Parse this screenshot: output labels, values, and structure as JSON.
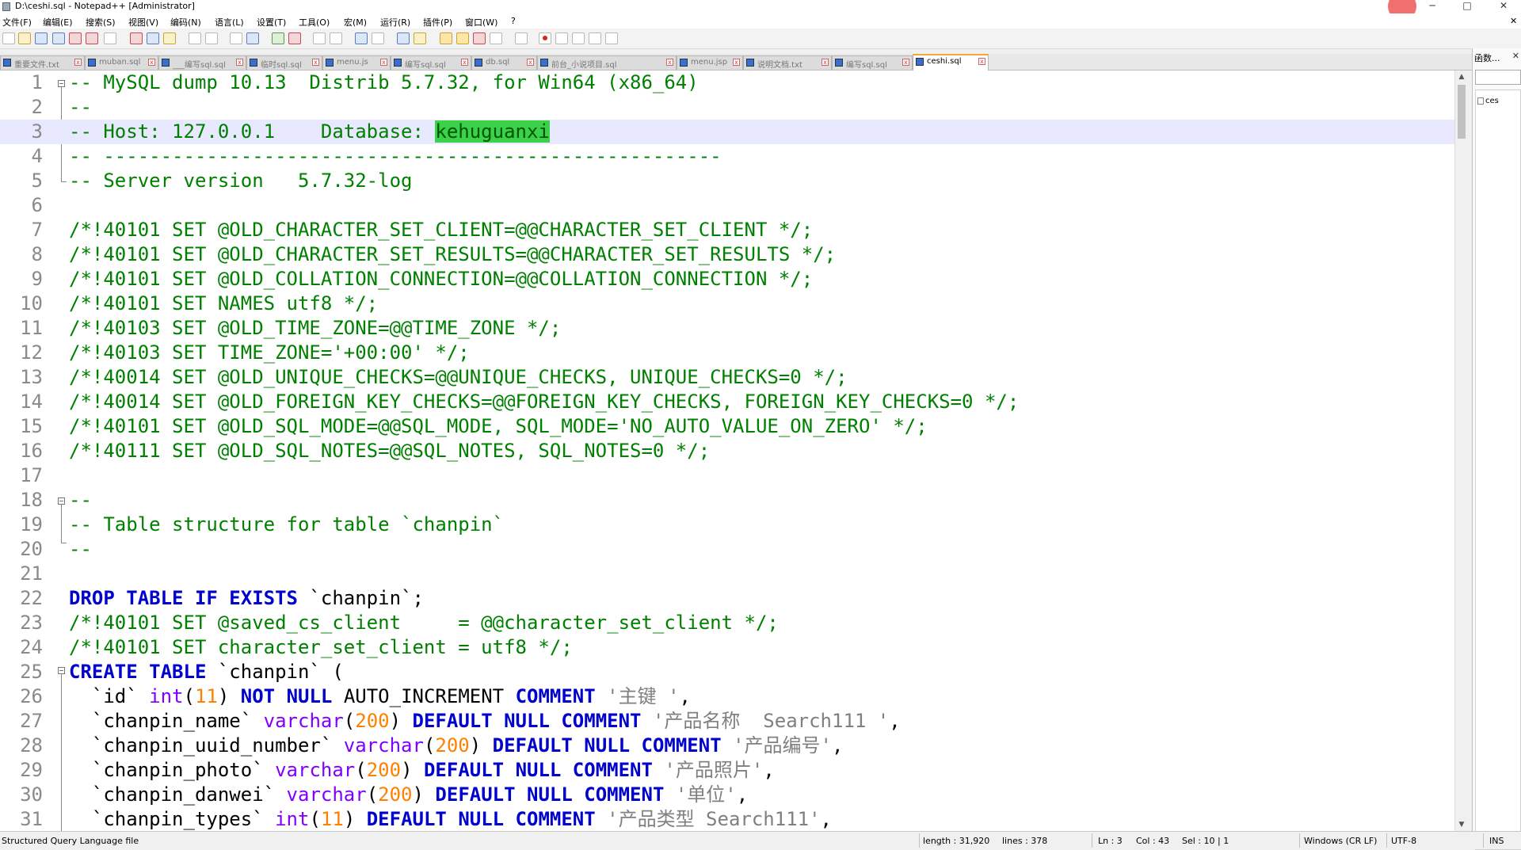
{
  "window": {
    "title": "D:\\ceshi.sql - Notepad++ [Administrator]",
    "minimize": "─",
    "maximize": "□",
    "close": "✕"
  },
  "menu": [
    {
      "label": "文件(F)"
    },
    {
      "label": "编辑(E)"
    },
    {
      "label": "搜索(S)"
    },
    {
      "label": "视图(V)"
    },
    {
      "label": "编码(N)"
    },
    {
      "label": "语言(L)"
    },
    {
      "label": "设置(T)"
    },
    {
      "label": "工具(O)"
    },
    {
      "label": "宏(M)"
    },
    {
      "label": "运行(R)"
    },
    {
      "label": "插件(P)"
    },
    {
      "label": "窗口(W)"
    },
    {
      "label": "?"
    }
  ],
  "menu_close": "✕",
  "tabs": [
    {
      "label": "重要文件.txt",
      "active": false
    },
    {
      "label": "muban.sql",
      "active": false
    },
    {
      "label": "___编写sql.sql",
      "active": false
    },
    {
      "label": "临时sql.sql",
      "active": false
    },
    {
      "label": "menu.js",
      "active": false
    },
    {
      "label": "编写sql.sql",
      "active": false
    },
    {
      "label": "db.sql",
      "active": false
    },
    {
      "label": "前台_小说项目.sql",
      "active": false
    },
    {
      "label": "menu.jsp",
      "active": false
    },
    {
      "label": "说明文档.txt",
      "active": false
    },
    {
      "label": "编写sql.sql",
      "active": false
    },
    {
      "label": "ceshi.sql",
      "active": true
    }
  ],
  "editor": {
    "current_line": 3,
    "lines": [
      {
        "n": "1",
        "tokens": [
          {
            "t": "cmt",
            "v": "-- MySQL dump 10.13  Distrib 5.7.32, for Win64 (x86_64)"
          }
        ]
      },
      {
        "n": "2",
        "tokens": [
          {
            "t": "cmt",
            "v": "--"
          }
        ]
      },
      {
        "n": "3",
        "tokens": [
          {
            "t": "cmt",
            "v": "-- Host: 127.0.0.1    Database: "
          },
          {
            "t": "hl",
            "v": "kehuguanxi"
          }
        ]
      },
      {
        "n": "4",
        "tokens": [
          {
            "t": "cmt",
            "v": "-- ------------------------------------------------------"
          }
        ]
      },
      {
        "n": "5",
        "tokens": [
          {
            "t": "cmt",
            "v": "-- Server version   5.7.32-log"
          }
        ]
      },
      {
        "n": "6",
        "tokens": []
      },
      {
        "n": "7",
        "tokens": [
          {
            "t": "cmt",
            "v": "/*!40101 SET @OLD_CHARACTER_SET_CLIENT=@@CHARACTER_SET_CLIENT */;"
          }
        ]
      },
      {
        "n": "8",
        "tokens": [
          {
            "t": "cmt",
            "v": "/*!40101 SET @OLD_CHARACTER_SET_RESULTS=@@CHARACTER_SET_RESULTS */;"
          }
        ]
      },
      {
        "n": "9",
        "tokens": [
          {
            "t": "cmt",
            "v": "/*!40101 SET @OLD_COLLATION_CONNECTION=@@COLLATION_CONNECTION */;"
          }
        ]
      },
      {
        "n": "10",
        "tokens": [
          {
            "t": "cmt",
            "v": "/*!40101 SET NAMES utf8 */;"
          }
        ]
      },
      {
        "n": "11",
        "tokens": [
          {
            "t": "cmt",
            "v": "/*!40103 SET @OLD_TIME_ZONE=@@TIME_ZONE */;"
          }
        ]
      },
      {
        "n": "12",
        "tokens": [
          {
            "t": "cmt",
            "v": "/*!40103 SET TIME_ZONE='+00:00' */;"
          }
        ]
      },
      {
        "n": "13",
        "tokens": [
          {
            "t": "cmt",
            "v": "/*!40014 SET @OLD_UNIQUE_CHECKS=@@UNIQUE_CHECKS, UNIQUE_CHECKS=0 */;"
          }
        ]
      },
      {
        "n": "14",
        "tokens": [
          {
            "t": "cmt",
            "v": "/*!40014 SET @OLD_FOREIGN_KEY_CHECKS=@@FOREIGN_KEY_CHECKS, FOREIGN_KEY_CHECKS=0 */;"
          }
        ]
      },
      {
        "n": "15",
        "tokens": [
          {
            "t": "cmt",
            "v": "/*!40101 SET @OLD_SQL_MODE=@@SQL_MODE, SQL_MODE='NO_AUTO_VALUE_ON_ZERO' */;"
          }
        ]
      },
      {
        "n": "16",
        "tokens": [
          {
            "t": "cmt",
            "v": "/*!40111 SET @OLD_SQL_NOTES=@@SQL_NOTES, SQL_NOTES=0 */;"
          }
        ]
      },
      {
        "n": "17",
        "tokens": []
      },
      {
        "n": "18",
        "tokens": [
          {
            "t": "cmt",
            "v": "--"
          }
        ]
      },
      {
        "n": "19",
        "tokens": [
          {
            "t": "cmt",
            "v": "-- Table structure for table `chanpin`"
          }
        ]
      },
      {
        "n": "20",
        "tokens": [
          {
            "t": "cmt",
            "v": "--"
          }
        ]
      },
      {
        "n": "21",
        "tokens": []
      },
      {
        "n": "22",
        "tokens": [
          {
            "t": "kw",
            "v": "DROP TABLE IF EXISTS"
          },
          {
            "t": "plain",
            "v": " `chanpin`;"
          }
        ]
      },
      {
        "n": "23",
        "tokens": [
          {
            "t": "cmt",
            "v": "/*!40101 SET @saved_cs_client     = @@character_set_client */;"
          }
        ]
      },
      {
        "n": "24",
        "tokens": [
          {
            "t": "cmt",
            "v": "/*!40101 SET character_set_client = utf8 */;"
          }
        ]
      },
      {
        "n": "25",
        "tokens": [
          {
            "t": "kw",
            "v": "CREATE TABLE"
          },
          {
            "t": "plain",
            "v": " `chanpin` ("
          }
        ]
      },
      {
        "n": "26",
        "tokens": [
          {
            "t": "plain",
            "v": "  `id` "
          },
          {
            "t": "type",
            "v": "int"
          },
          {
            "t": "plain",
            "v": "("
          },
          {
            "t": "num",
            "v": "11"
          },
          {
            "t": "plain",
            "v": ") "
          },
          {
            "t": "kw",
            "v": "NOT NULL"
          },
          {
            "t": "plain",
            "v": " AUTO_INCREMENT "
          },
          {
            "t": "kw",
            "v": "COMMENT"
          },
          {
            "t": "plain",
            "v": " "
          },
          {
            "t": "str",
            "v": "'主键 '"
          },
          {
            "t": "plain",
            "v": ","
          }
        ]
      },
      {
        "n": "27",
        "tokens": [
          {
            "t": "plain",
            "v": "  `chanpin_name` "
          },
          {
            "t": "type",
            "v": "varchar"
          },
          {
            "t": "plain",
            "v": "("
          },
          {
            "t": "num",
            "v": "200"
          },
          {
            "t": "plain",
            "v": ") "
          },
          {
            "t": "kw",
            "v": "DEFAULT NULL COMMENT"
          },
          {
            "t": "plain",
            "v": " "
          },
          {
            "t": "str",
            "v": "'产品名称  Search111 '"
          },
          {
            "t": "plain",
            "v": ","
          }
        ]
      },
      {
        "n": "28",
        "tokens": [
          {
            "t": "plain",
            "v": "  `chanpin_uuid_number` "
          },
          {
            "t": "type",
            "v": "varchar"
          },
          {
            "t": "plain",
            "v": "("
          },
          {
            "t": "num",
            "v": "200"
          },
          {
            "t": "plain",
            "v": ") "
          },
          {
            "t": "kw",
            "v": "DEFAULT NULL COMMENT"
          },
          {
            "t": "plain",
            "v": " "
          },
          {
            "t": "str",
            "v": "'产品编号'"
          },
          {
            "t": "plain",
            "v": ","
          }
        ]
      },
      {
        "n": "29",
        "tokens": [
          {
            "t": "plain",
            "v": "  `chanpin_photo` "
          },
          {
            "t": "type",
            "v": "varchar"
          },
          {
            "t": "plain",
            "v": "("
          },
          {
            "t": "num",
            "v": "200"
          },
          {
            "t": "plain",
            "v": ") "
          },
          {
            "t": "kw",
            "v": "DEFAULT NULL COMMENT"
          },
          {
            "t": "plain",
            "v": " "
          },
          {
            "t": "str",
            "v": "'产品照片'"
          },
          {
            "t": "plain",
            "v": ","
          }
        ]
      },
      {
        "n": "30",
        "tokens": [
          {
            "t": "plain",
            "v": "  `chanpin_danwei` "
          },
          {
            "t": "type",
            "v": "varchar"
          },
          {
            "t": "plain",
            "v": "("
          },
          {
            "t": "num",
            "v": "200"
          },
          {
            "t": "plain",
            "v": ") "
          },
          {
            "t": "kw",
            "v": "DEFAULT NULL COMMENT"
          },
          {
            "t": "plain",
            "v": " "
          },
          {
            "t": "str",
            "v": "'单位'"
          },
          {
            "t": "plain",
            "v": ","
          }
        ]
      },
      {
        "n": "31",
        "tokens": [
          {
            "t": "plain",
            "v": "  `chanpin_types` "
          },
          {
            "t": "type",
            "v": "int"
          },
          {
            "t": "plain",
            "v": "("
          },
          {
            "t": "num",
            "v": "11"
          },
          {
            "t": "plain",
            "v": ") "
          },
          {
            "t": "kw",
            "v": "DEFAULT NULL COMMENT"
          },
          {
            "t": "plain",
            "v": " "
          },
          {
            "t": "str",
            "v": "'产品类型 Search111'"
          },
          {
            "t": "plain",
            "v": ","
          }
        ]
      }
    ]
  },
  "function_panel": {
    "title": "函数...",
    "close": "✕",
    "tree_root": "ces"
  },
  "status": {
    "language": "Structured Query Language file",
    "length": "length : 31,920",
    "lines": "lines : 378",
    "ln": "Ln : 3",
    "col": "Col : 43",
    "sel": "Sel : 10 | 1",
    "eol": "Windows (CR LF)",
    "encoding": "UTF-8",
    "mode": "INS"
  },
  "colors": {
    "comment": "#008000",
    "keyword": "#0000cc",
    "type": "#8000ff",
    "number": "#ff8000",
    "string": "#808080",
    "highlight": "#3bd14a",
    "current_line": "#e8e8ff",
    "active_tab_accent": "#f2a838"
  }
}
